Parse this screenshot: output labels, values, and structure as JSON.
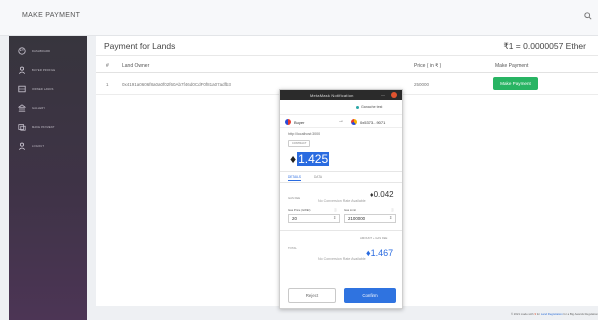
{
  "topbar": {
    "brand": "MAKE PAYMENT"
  },
  "sidebar": {
    "items": [
      {
        "label": "Dashboard",
        "icon": "palette-icon"
      },
      {
        "label": "Buyer Profile",
        "icon": "user-icon"
      },
      {
        "label": "Owned Lands",
        "icon": "map-icon"
      },
      {
        "label": "Gallery",
        "icon": "bank-icon"
      },
      {
        "label": "Make Payment",
        "icon": "payment-icon"
      },
      {
        "label": "Logout",
        "icon": "logout-icon"
      }
    ]
  },
  "main": {
    "title": "Payment for Lands",
    "rate": "₹1 = 0.0000057 Ether",
    "table": {
      "headers": [
        "#",
        "Land Owner",
        "Price ( in ₹ )",
        "Make Payment"
      ],
      "rows": [
        {
          "index": "1",
          "owner": "0x4191a0606f8a0a0f02f60Ab7f46d0CdF0f81a07adfb3",
          "price": "250000",
          "action": "Make Payment"
        }
      ]
    }
  },
  "footer": {
    "prefix": "© 2021 made with",
    "link": "Land Registration",
    "suffix": "for a Big Awards Regulation"
  },
  "metamask": {
    "title": "MetaMask Notification",
    "network": "Ganache test",
    "from_account": "Buyer",
    "to_account": "0x5373...9071",
    "origin": "http://localhost:3000",
    "badge": "CONTRACT",
    "amount": "1.425",
    "tabs": {
      "details": "DETAILS",
      "data": "DATA"
    },
    "gas_fee_label": "GAS FEE",
    "gas_fee": "0.042",
    "no_conversion": "No Conversion Rate Available",
    "gas_price_label": "Gas Price (GWEI)",
    "gas_limit_label": "Gas Limit",
    "gas_price_value": "20",
    "gas_limit_value": "2100000",
    "amount_gas_label": "AMOUNT + GAS FEE",
    "total_label": "TOTAL",
    "total": "1.467",
    "reject_label": "Reject",
    "confirm_label": "Confirm"
  },
  "colors": {
    "accent": "#2f73e0",
    "success": "#28b463",
    "sidebar": "#3f3347"
  }
}
